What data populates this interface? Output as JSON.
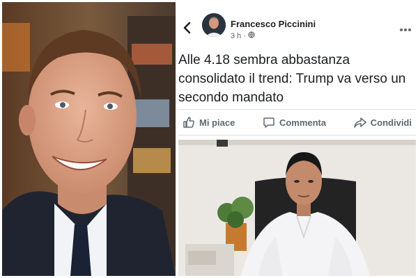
{
  "post": {
    "author": "Francesco Piccinini",
    "time": "3 h",
    "separator": "·",
    "text": "Alle 4.18 sembra abbastanza consolidato il trend: Trump va verso un secondo mandato"
  },
  "actions": {
    "like": "Mi piace",
    "comment": "Commenta",
    "share": "Condividi"
  },
  "icons": {
    "back": "chevron-left-icon",
    "privacy": "globe-icon",
    "more": "more-horizontal-icon",
    "like": "thumbs-up-icon",
    "comment": "comment-icon",
    "share": "share-icon"
  }
}
